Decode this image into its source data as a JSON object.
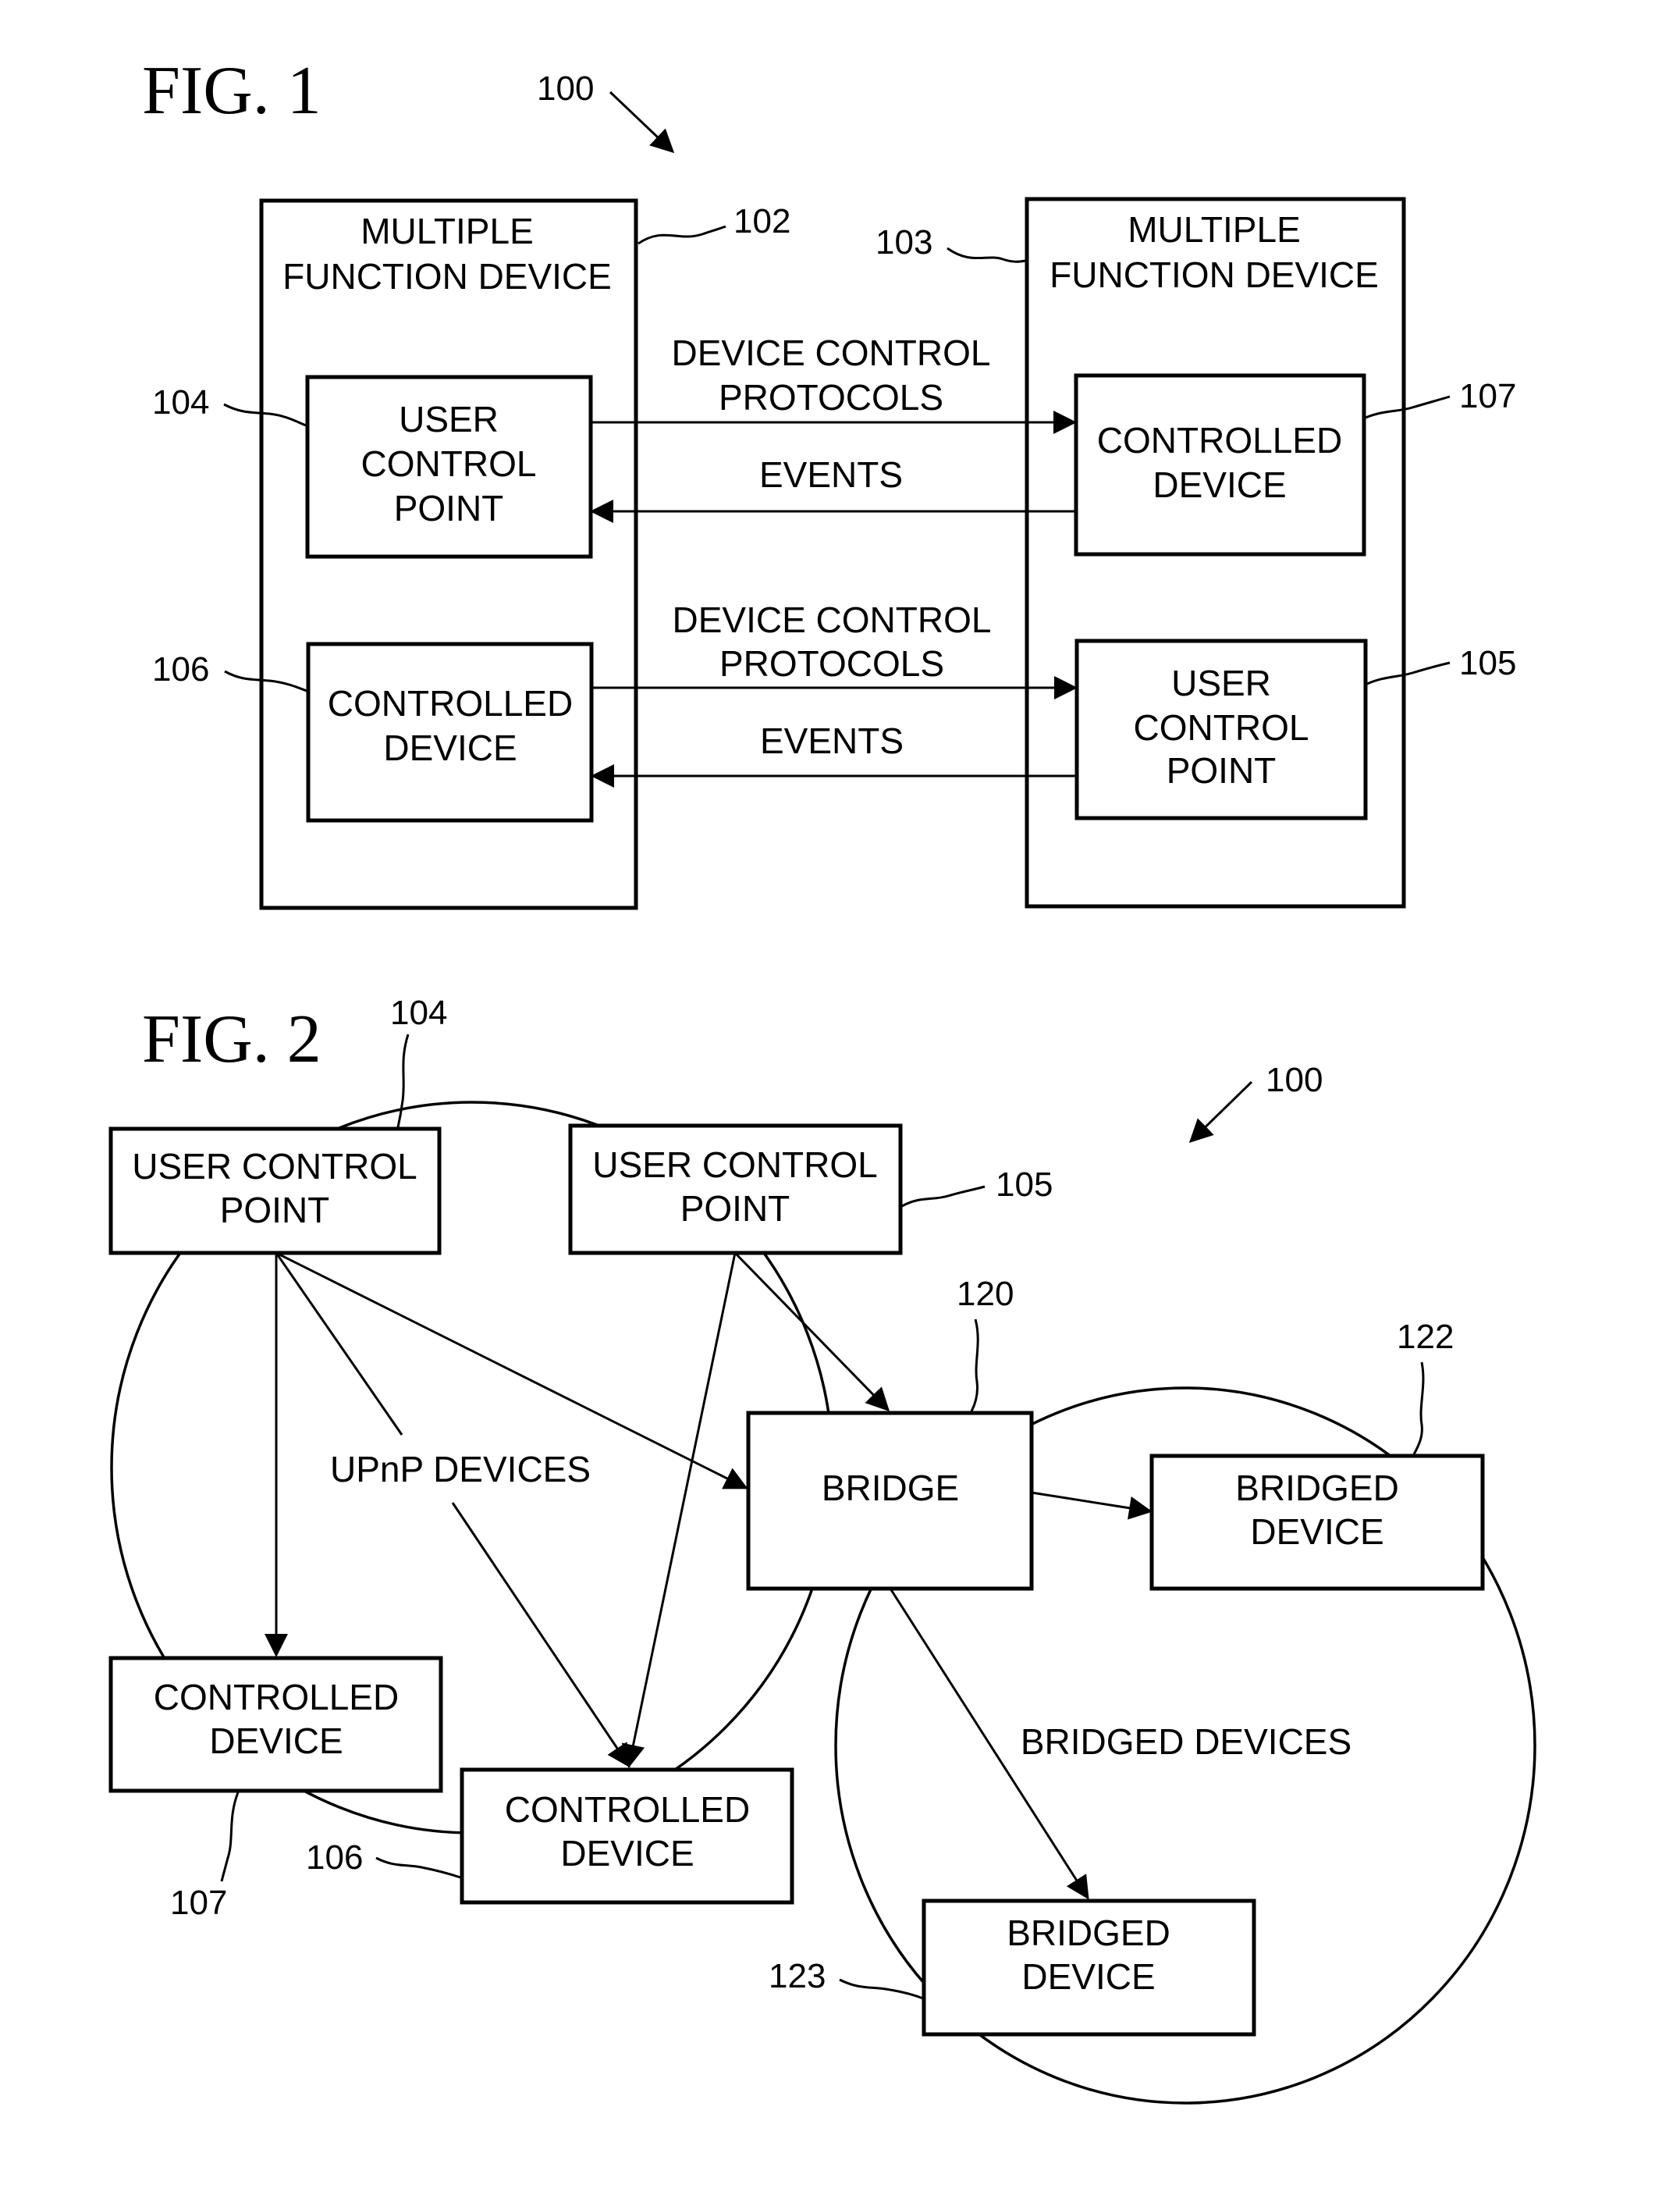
{
  "fig1": {
    "title": "FIG. 1",
    "ref_system": "100",
    "left_device": {
      "ref": "102",
      "lines": [
        "MULTIPLE",
        "FUNCTION DEVICE"
      ]
    },
    "right_device": {
      "ref": "103",
      "lines": [
        "MULTIPLE",
        "FUNCTION DEVICE"
      ]
    },
    "ucp_104": {
      "ref": "104",
      "lines": [
        "USER",
        "CONTROL",
        "POINT"
      ]
    },
    "cd_106": {
      "ref": "106",
      "lines": [
        "CONTROLLED",
        "DEVICE"
      ]
    },
    "cd_107": {
      "ref": "107",
      "lines": [
        "CONTROLLED",
        "DEVICE"
      ]
    },
    "ucp_105": {
      "ref": "105",
      "lines": [
        "USER",
        "CONTROL",
        "POINT"
      ]
    },
    "link_top": {
      "protocol_lines": [
        "DEVICE CONTROL",
        "PROTOCOLS"
      ],
      "events": "EVENTS"
    },
    "link_bottom": {
      "protocol_lines": [
        "DEVICE CONTROL",
        "PROTOCOLS"
      ],
      "events": "EVENTS"
    }
  },
  "fig2": {
    "title": "FIG. 2",
    "ref_system": "100",
    "ucp_104": {
      "ref": "104",
      "lines": [
        "USER CONTROL",
        "POINT"
      ]
    },
    "ucp_105": {
      "ref": "105",
      "lines": [
        "USER CONTROL",
        "POINT"
      ]
    },
    "bridge": {
      "ref": "120",
      "lines": [
        "BRIDGE"
      ]
    },
    "bridged_122": {
      "ref": "122",
      "lines": [
        "BRIDGED",
        "DEVICE"
      ]
    },
    "cd_107": {
      "ref": "107",
      "lines": [
        "CONTROLLED",
        "DEVICE"
      ]
    },
    "cd_106": {
      "ref": "106",
      "lines": [
        "CONTROLLED",
        "DEVICE"
      ]
    },
    "bridged_123": {
      "ref": "123",
      "lines": [
        "BRIDGED",
        "DEVICE"
      ]
    },
    "upnp_group_label": "UPnP DEVICES",
    "bridged_group_label": "BRIDGED DEVICES"
  }
}
